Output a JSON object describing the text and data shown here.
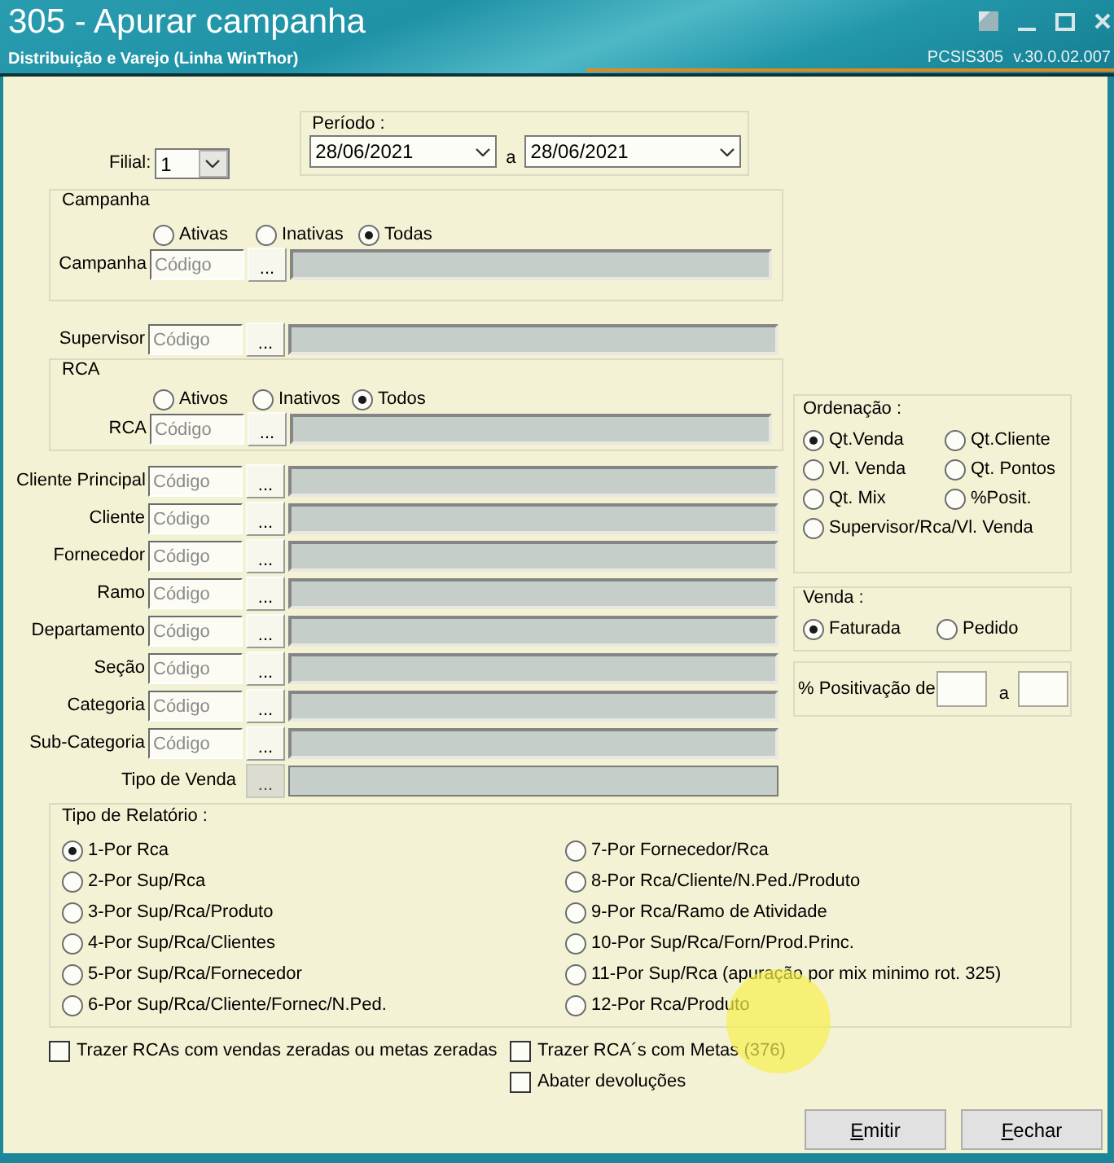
{
  "window": {
    "title": "305 - Apurar campanha",
    "subtitle": "Distribuição e Varejo (Linha WinThor)",
    "program": "PCSIS305",
    "version": "v.30.0.02.007"
  },
  "filial": {
    "label": "Filial:",
    "value": "1"
  },
  "periodo": {
    "label": "Período :",
    "from": "28/06/2021",
    "separator": "a",
    "to": "28/06/2021"
  },
  "campanha": {
    "title": "Campanha",
    "options": [
      {
        "label": "Ativas",
        "selected": false
      },
      {
        "label": "Inativas",
        "selected": false
      },
      {
        "label": "Todas",
        "selected": true
      }
    ],
    "field": {
      "label": "Campanha",
      "placeholder": "Código",
      "button": "..."
    }
  },
  "supervisor": {
    "label": "Supervisor",
    "placeholder": "Código",
    "button": "..."
  },
  "rca": {
    "title": "RCA",
    "options": [
      {
        "label": "Ativos",
        "selected": false
      },
      {
        "label": "Inativos",
        "selected": false
      },
      {
        "label": "Todos",
        "selected": true
      }
    ],
    "field": {
      "label": "RCA",
      "placeholder": "Código",
      "button": "..."
    }
  },
  "filters": [
    {
      "label": "Cliente Principal",
      "placeholder": "Código",
      "button": "..."
    },
    {
      "label": "Cliente",
      "placeholder": "Código",
      "button": "..."
    },
    {
      "label": "Fornecedor",
      "placeholder": "Código",
      "button": "..."
    },
    {
      "label": "Ramo",
      "placeholder": "Código",
      "button": "..."
    },
    {
      "label": "Departamento",
      "placeholder": "Código",
      "button": "..."
    },
    {
      "label": "Seção",
      "placeholder": "Código",
      "button": "..."
    },
    {
      "label": "Categoria",
      "placeholder": "Código",
      "button": "..."
    },
    {
      "label": "Sub-Categoria",
      "placeholder": "Código",
      "button": "..."
    }
  ],
  "tipo_de_venda": {
    "label": "Tipo de Venda",
    "button": "...",
    "disabled": true
  },
  "ordenacao": {
    "title": "Ordenação :",
    "options": [
      {
        "label": "Qt.Venda",
        "selected": true
      },
      {
        "label": "Qt.Cliente",
        "selected": false
      },
      {
        "label": "Vl. Venda",
        "selected": false
      },
      {
        "label": "Qt. Pontos",
        "selected": false
      },
      {
        "label": "Qt. Mix",
        "selected": false
      },
      {
        "label": "%Posit.",
        "selected": false
      },
      {
        "label": "Supervisor/Rca/Vl. Venda",
        "selected": false
      }
    ]
  },
  "venda": {
    "title": "Venda :",
    "options": [
      {
        "label": "Faturada",
        "selected": true
      },
      {
        "label": "Pedido",
        "selected": false
      }
    ]
  },
  "positivacao": {
    "label": "% Positivação de",
    "separator": "a"
  },
  "tipo_de_relatorio": {
    "title": "Tipo de Relatório :",
    "options": [
      {
        "label": "1-Por Rca",
        "selected": true
      },
      {
        "label": "2-Por Sup/Rca",
        "selected": false
      },
      {
        "label": "3-Por Sup/Rca/Produto",
        "selected": false
      },
      {
        "label": "4-Por Sup/Rca/Clientes",
        "selected": false
      },
      {
        "label": "5-Por Sup/Rca/Fornecedor",
        "selected": false
      },
      {
        "label": "6-Por Sup/Rca/Cliente/Fornec/N.Ped.",
        "selected": false
      },
      {
        "label": "7-Por Fornecedor/Rca",
        "selected": false
      },
      {
        "label": "8-Por Rca/Cliente/N.Ped./Produto",
        "selected": false
      },
      {
        "label": "9-Por Rca/Ramo de Atividade",
        "selected": false
      },
      {
        "label": "10-Por Sup/Rca/Forn/Prod.Princ.",
        "selected": false
      },
      {
        "label": "11-Por Sup/Rca (apuração por mix minimo rot. 325)",
        "selected": false
      },
      {
        "label": "12-Por Rca/Produto",
        "selected": false
      }
    ]
  },
  "checkboxes": [
    {
      "label": "Trazer RCAs com vendas zeradas ou metas zeradas",
      "checked": false
    },
    {
      "label": "Trazer RCA´s com Metas (376)",
      "checked": false
    },
    {
      "label": "Abater devoluções",
      "checked": false
    }
  ],
  "buttons": [
    {
      "label": "Emitir"
    },
    {
      "label": "Fechar"
    }
  ]
}
